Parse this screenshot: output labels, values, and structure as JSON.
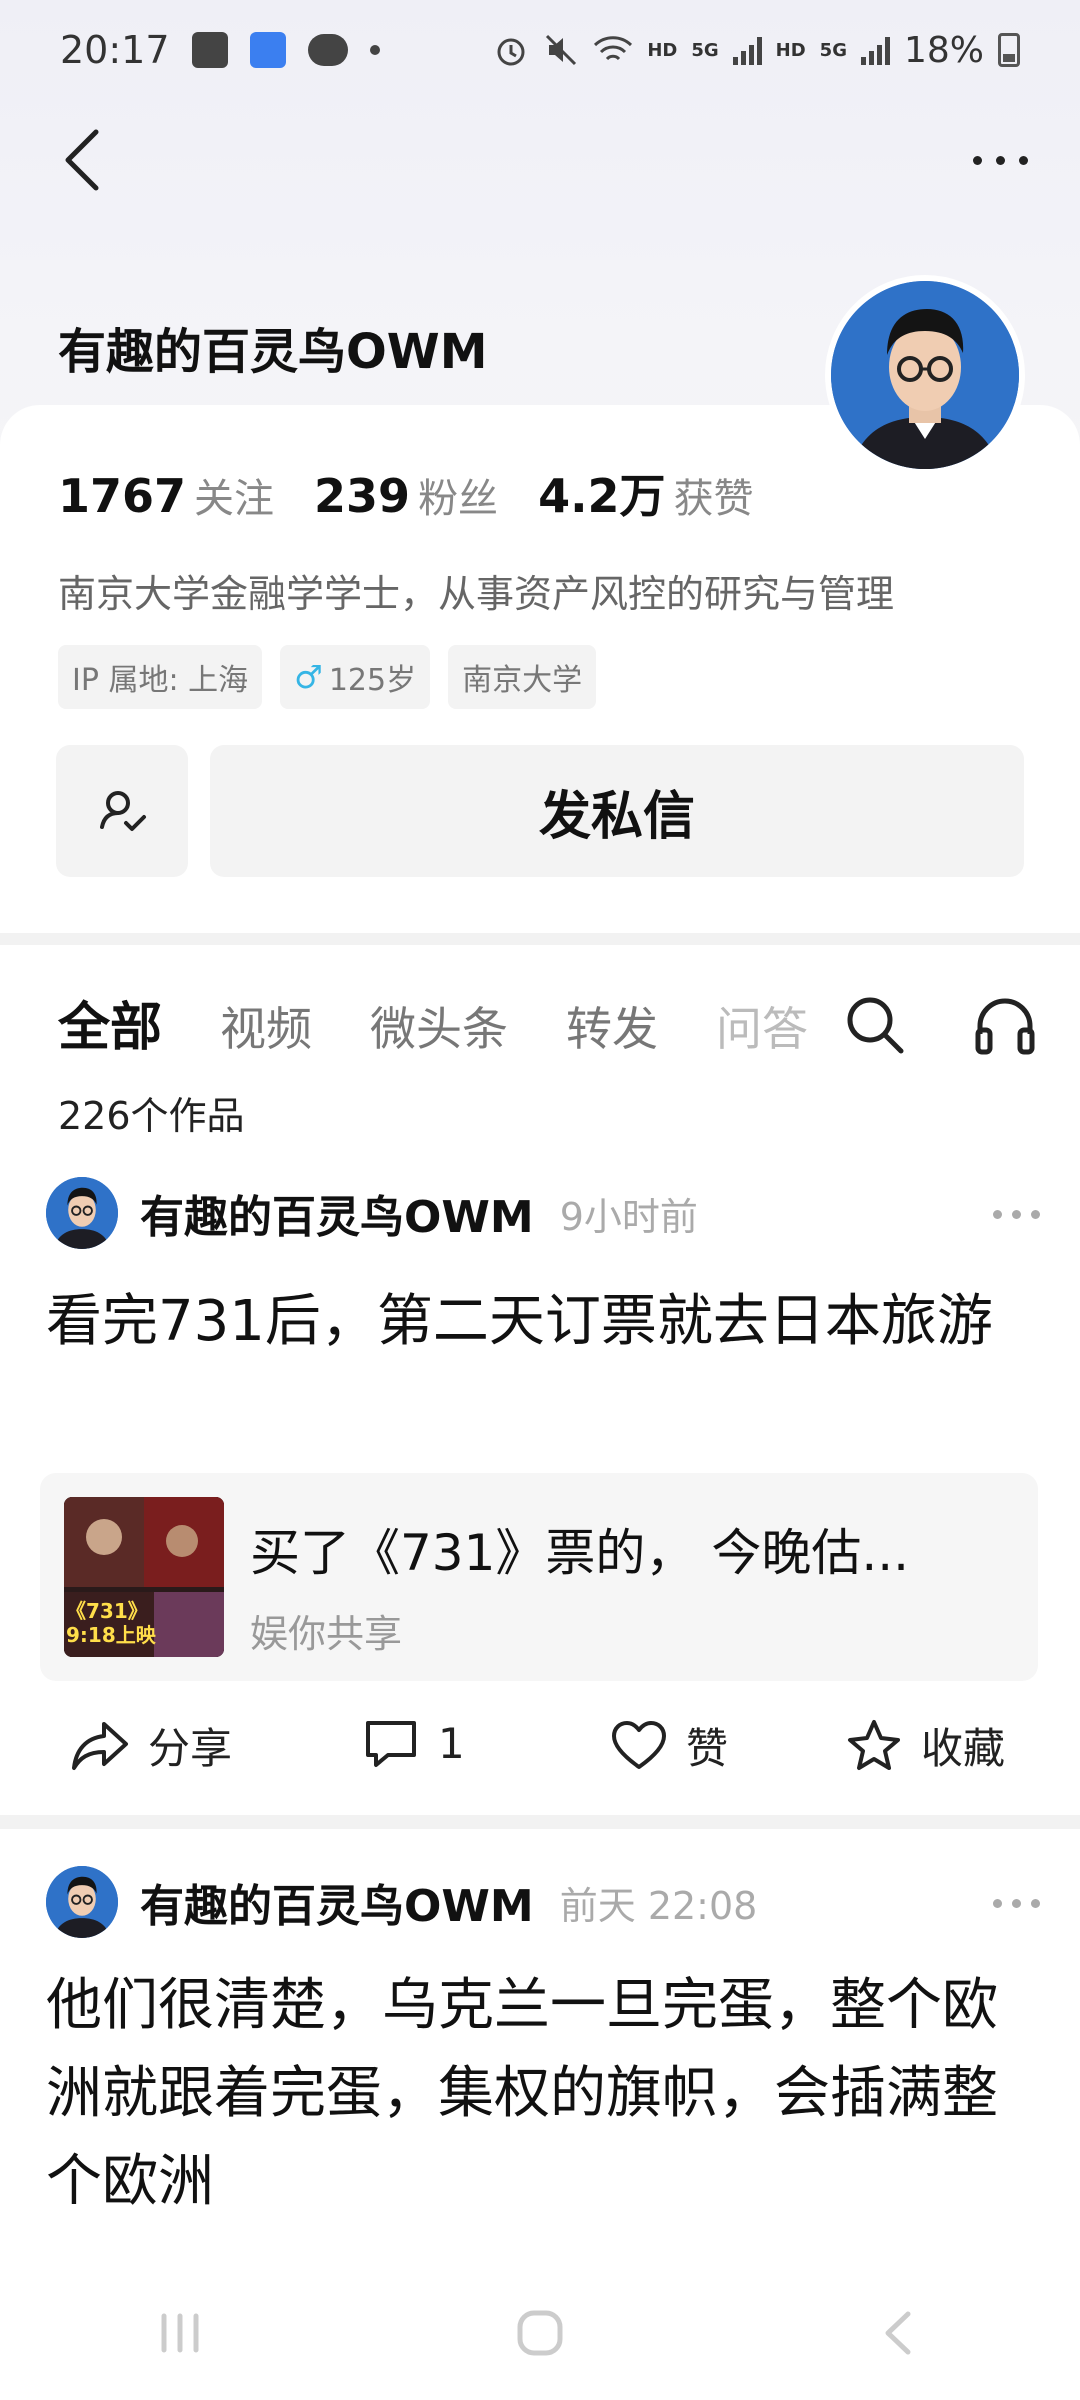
{
  "status_bar": {
    "time": "20:17",
    "battery": "18%",
    "hd_label_1": "HD",
    "hd_label_2": "HD",
    "net_label_1": "5G",
    "net_label_2": "5G",
    "icons": [
      "photo-icon",
      "weather-icon",
      "wechat-icon",
      "alarm-icon",
      "mute-icon",
      "wifi-icon",
      "signal-icon",
      "battery-icon"
    ]
  },
  "profile": {
    "name": "有趣的百灵鸟OWM",
    "stats": [
      {
        "value": "1767",
        "label": "关注"
      },
      {
        "value": "239",
        "label": "粉丝"
      },
      {
        "value": "4.2万",
        "label": "获赞"
      }
    ],
    "bio": "南京大学金融学学士，从事资产风控的研究与管理",
    "tags": {
      "ip": "IP 属地: 上海",
      "age": "125岁",
      "school": "南京大学"
    },
    "message_button": "发私信"
  },
  "tabs": [
    "全部",
    "视频",
    "微头条",
    "转发",
    "问答"
  ],
  "works_count": "226个作品",
  "posts": [
    {
      "author": "有趣的百灵鸟OWM",
      "time": "9小时前",
      "text": "看完731后，第二天订票就去日本旅游",
      "link": {
        "title": "买了《731》票的， 今晚估...",
        "source": "娱你共享",
        "thumb_caption_1": "《731》",
        "thumb_caption_2": "9:18上映"
      },
      "actions": {
        "share": "分享",
        "comments": "1",
        "like": "赞",
        "favorite": "收藏"
      }
    },
    {
      "author": "有趣的百灵鸟OWM",
      "time": "前天  22:08",
      "text": "他们很清楚，乌克兰一旦完蛋，整个欧洲就跟着完蛋，集权的旗帜，会插满整个欧洲"
    }
  ],
  "colors": {
    "avatar_bg": "#2f72c8",
    "age_icon": "#35b5e5"
  }
}
